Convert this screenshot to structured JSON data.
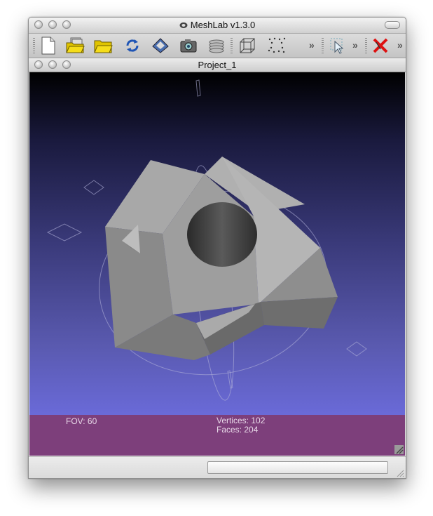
{
  "window": {
    "title": "MeshLab v1.3.0"
  },
  "toolbar": {
    "buttons": [
      {
        "name": "new-document",
        "icon": "new-document-icon"
      },
      {
        "name": "open-project",
        "icon": "open-project-folder-icon"
      },
      {
        "name": "import-mesh",
        "icon": "open-folder-icon"
      },
      {
        "name": "reload",
        "icon": "reload-arrows-icon"
      },
      {
        "name": "save",
        "icon": "save-disk-icon"
      },
      {
        "name": "snapshot",
        "icon": "camera-icon"
      },
      {
        "name": "layers",
        "icon": "layers-icon"
      },
      {
        "name": "bbox",
        "icon": "bounding-box-icon"
      },
      {
        "name": "points",
        "icon": "point-cloud-icon"
      },
      {
        "name": "select",
        "icon": "cursor-select-icon"
      },
      {
        "name": "delete",
        "icon": "delete-x-icon"
      }
    ],
    "overflow": "»"
  },
  "subwindow": {
    "title": "Project_1"
  },
  "viewport": {
    "colors": {
      "bg_top": "#000000",
      "bg_bottom": "#6a6ad8",
      "mesh": "#9a9a9a"
    }
  },
  "info": {
    "fov": "FOV: 60",
    "vertices": "Vertices: 102",
    "faces": "Faces: 204",
    "bg": "#7d3f7b"
  }
}
